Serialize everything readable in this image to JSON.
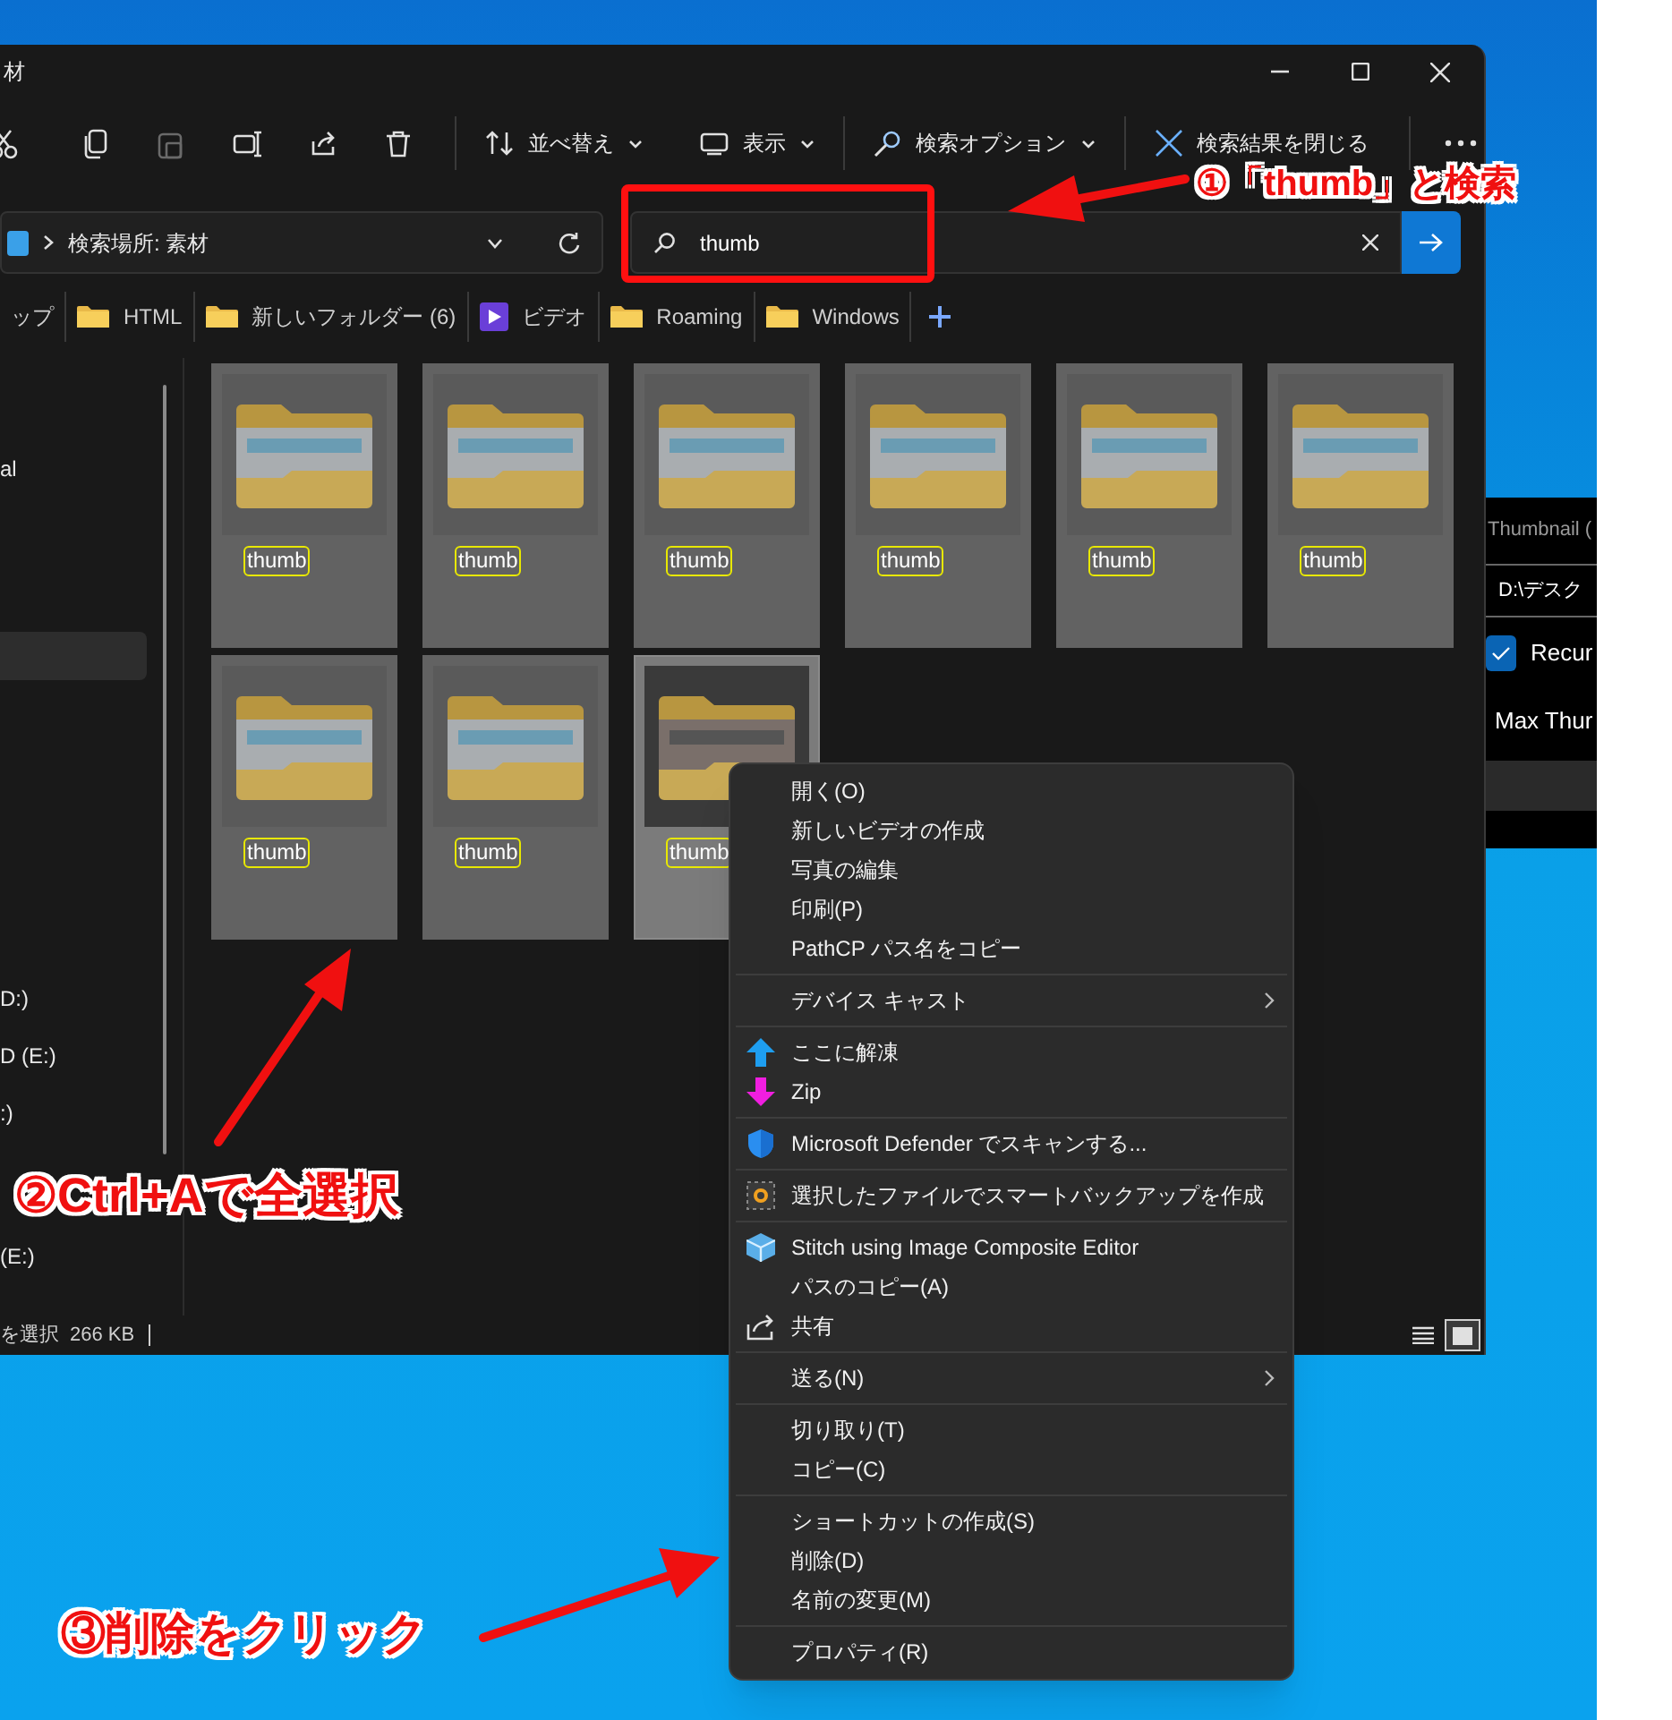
{
  "window": {
    "title": "材"
  },
  "toolbar": {
    "buttons": [
      {
        "label": "並べ替え",
        "kind": "sort"
      },
      {
        "label": "表示",
        "kind": "view"
      },
      {
        "label": "検索オプション",
        "kind": "options"
      },
      {
        "label": "検索結果を閉じる",
        "kind": "close"
      }
    ]
  },
  "address_bar": {
    "path": "検索場所: 素材"
  },
  "search": {
    "value": "thumb"
  },
  "quick_tabs": [
    {
      "label": "ップ",
      "kind": "text"
    },
    {
      "label": "HTML",
      "kind": "folder"
    },
    {
      "label": "新しいフォルダー (6)",
      "kind": "folder"
    },
    {
      "label": "ビデオ",
      "kind": "video"
    },
    {
      "label": "Roaming",
      "kind": "folder"
    },
    {
      "label": "Windows",
      "kind": "folder"
    }
  ],
  "sidebar": {
    "items": [
      {
        "label": "al",
        "selected": false
      },
      {
        "selected": true
      },
      {
        "label": "D:)",
        "selected": false
      },
      {
        "label": "D (E:)",
        "selected": false
      },
      {
        "label": ":)",
        "selected": false
      },
      {
        "label": "(E:)",
        "selected": false
      }
    ]
  },
  "files": [
    {
      "name": "thumb",
      "selected": true,
      "focused": false
    },
    {
      "name": "thumb",
      "selected": true,
      "focused": false
    },
    {
      "name": "thumb",
      "selected": true,
      "focused": false
    },
    {
      "name": "thumb",
      "selected": true,
      "focused": false
    },
    {
      "name": "thumb",
      "selected": true,
      "focused": false
    },
    {
      "name": "thumb",
      "selected": true,
      "focused": false
    },
    {
      "name": "thumb",
      "selected": true,
      "focused": false
    },
    {
      "name": "thumb",
      "selected": true,
      "focused": false
    },
    {
      "name": "thumb",
      "selected": true,
      "focused": true
    }
  ],
  "status_bar": {
    "selection": "を選択",
    "size": "266 KB",
    "views": [
      {
        "kind": "details",
        "selected": false
      },
      {
        "kind": "tiles",
        "selected": true
      }
    ]
  },
  "context_menu": {
    "groups": [
      [
        {
          "label": "開く(O)"
        },
        {
          "label": "新しいビデオの作成"
        },
        {
          "label": "写真の編集"
        },
        {
          "label": "印刷(P)"
        },
        {
          "label": "PathCP パス名をコピー"
        }
      ],
      [
        {
          "label": "デバイス キャスト",
          "submenu": true
        }
      ],
      [
        {
          "label": "ここに解凍",
          "kind": "extract"
        },
        {
          "label": "Zip",
          "kind": "zip"
        }
      ],
      [
        {
          "label": "Microsoft Defender でスキャンする...",
          "kind": "defender"
        }
      ],
      [
        {
          "label": "選択したファイルでスマートバックアップを作成",
          "kind": "backup"
        }
      ],
      [
        {
          "label": "Stitch using Image Composite Editor",
          "kind": "stitch"
        },
        {
          "label": "パスのコピー(A)"
        },
        {
          "label": "共有",
          "kind": "share"
        }
      ],
      [
        {
          "label": "送る(N)",
          "submenu": true
        }
      ],
      [
        {
          "label": "切り取り(T)"
        },
        {
          "label": "コピー(C)"
        }
      ],
      [
        {
          "label": "ショートカットの作成(S)"
        },
        {
          "label": "削除(D)"
        },
        {
          "label": "名前の変更(M)"
        }
      ],
      [
        {
          "label": "プロパティ(R)"
        }
      ]
    ]
  },
  "background_window": {
    "title": "Thumbnail (",
    "path": "D:\\デスク",
    "checkbox": {
      "label": "Recur",
      "checked": true
    },
    "field_label": "Max Thur"
  },
  "annotations": [
    {
      "text": "①「thumb」と検索"
    },
    {
      "text": "②Ctrl+Aで全選択"
    },
    {
      "text": "③削除をクリック"
    }
  ]
}
